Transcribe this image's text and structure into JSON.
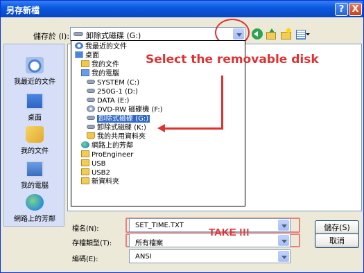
{
  "window": {
    "title": "另存新檔"
  },
  "titlebar": {
    "help_label": "?",
    "close_label": "X"
  },
  "toolbar": {
    "save_in_label": "儲存於 (I):",
    "save_in_value": "卸除式磁碟 (G:)"
  },
  "places": [
    {
      "label": "我最近的文件"
    },
    {
      "label": "桌面"
    },
    {
      "label": "我的文件"
    },
    {
      "label": "我的電腦"
    },
    {
      "label": "網路上的芳鄰"
    }
  ],
  "dropdown": {
    "items": [
      {
        "label": "我最近的文件"
      },
      {
        "label": "桌面"
      },
      {
        "label": "我的文件"
      },
      {
        "label": "我的電腦"
      },
      {
        "label": "SYSTEM (C:)"
      },
      {
        "label": "250G-1 (D:)"
      },
      {
        "label": "DATA (E:)"
      },
      {
        "label": "DVD-RW 磁碟機 (F:)"
      },
      {
        "label": "卸除式磁碟 (G:)"
      },
      {
        "label": "卸除式磁碟 (K:)"
      },
      {
        "label": "我的共用資料夾"
      },
      {
        "label": "網路上的芳鄰"
      },
      {
        "label": "ProEngineer"
      },
      {
        "label": "USB"
      },
      {
        "label": "USB2"
      },
      {
        "label": "新資料夾"
      }
    ]
  },
  "annotation": {
    "select_text": "Select the removable disk",
    "take_text": "TAKE !!!",
    "color": "#e03030"
  },
  "form": {
    "filename_label": "檔名(N):",
    "filename_value": "SET_TIME.TXT",
    "filetype_label": "存檔類型(T):",
    "filetype_value": "所有檔案",
    "encoding_label": "編碼(E):",
    "encoding_value": "ANSI"
  },
  "buttons": {
    "save": "儲存(S)",
    "cancel": "取消"
  },
  "colors": {
    "titlebar": "#0a5ae0",
    "selection": "#316ac5",
    "highlight_box": "#e88080"
  }
}
